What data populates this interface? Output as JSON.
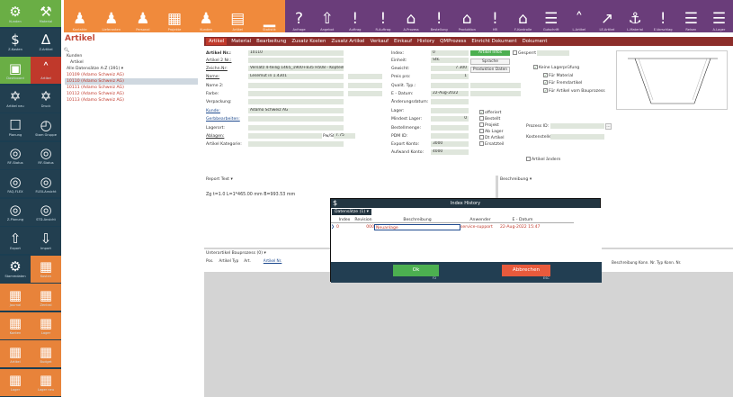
{
  "toolbar": {
    "orange_items": [
      {
        "icon": "person-icon",
        "glyph": "♟",
        "label": "Kontakte"
      },
      {
        "icon": "person-icon",
        "glyph": "♟",
        "label": "Lieferanten"
      },
      {
        "icon": "people-icon",
        "glyph": "♟",
        "label": "Personal"
      },
      {
        "icon": "grid-icon",
        "glyph": "▦",
        "label": "Projekte"
      },
      {
        "icon": "people-icon",
        "glyph": "♟",
        "label": "Kunden"
      },
      {
        "icon": "table-icon",
        "glyph": "▤",
        "label": "Artikel"
      },
      {
        "icon": "chart-icon",
        "glyph": "▁",
        "label": "Statistik"
      }
    ],
    "purple_items": [
      {
        "icon": "question-icon",
        "glyph": "?",
        "label": "Anfrage"
      },
      {
        "icon": "export-icon",
        "glyph": "⇧",
        "label": "Angebot"
      },
      {
        "icon": "alert-icon",
        "glyph": "!",
        "label": "Auftrag"
      },
      {
        "icon": "alert-icon",
        "glyph": "!",
        "label": "R-Auftrag"
      },
      {
        "icon": "home-icon",
        "glyph": "⌂",
        "label": "A-Prozess"
      },
      {
        "icon": "alert-icon",
        "glyph": "!",
        "label": "Bestellung"
      },
      {
        "icon": "home-icon",
        "glyph": "⌂",
        "label": "Produktion"
      },
      {
        "icon": "alert-icon",
        "glyph": "!",
        "label": "HR"
      },
      {
        "icon": "home-icon",
        "glyph": "⌂",
        "label": "F-Kontrolle"
      },
      {
        "icon": "doc-icon",
        "glyph": "☰",
        "label": "Gutschrift"
      },
      {
        "icon": "arrow-up-icon",
        "glyph": "˄",
        "label": "L-Artikel"
      },
      {
        "icon": "arrow-icon",
        "glyph": "↗",
        "label": "LE-Artikel"
      },
      {
        "icon": "ship-icon",
        "glyph": "⚓",
        "label": "L-Material"
      },
      {
        "icon": "alert-icon",
        "glyph": "!",
        "label": "E-Vorschlag"
      },
      {
        "icon": "doc-icon",
        "glyph": "☰",
        "label": "Reisen"
      },
      {
        "icon": "doc-icon",
        "glyph": "☰",
        "label": "A-Lager"
      }
    ]
  },
  "sidebar": {
    "items": [
      {
        "icon": "gear-icon",
        "glyph": "⚙",
        "label": "Kunden",
        "color": "green"
      },
      {
        "icon": "material-icon",
        "glyph": "⚒",
        "label": "Material",
        "color": "green"
      },
      {
        "icon": "dollar-icon",
        "glyph": "$",
        "label": "Z-Kosten",
        "color": "dark"
      },
      {
        "icon": "triangle-icon",
        "glyph": "∆",
        "label": "Z-Artikel",
        "color": "dark"
      },
      {
        "icon": "board-icon",
        "glyph": "▣",
        "label": "Dashboard",
        "color": "green"
      },
      {
        "icon": "artikel-icon",
        "glyph": "˄",
        "label": "Artikel",
        "color": "red"
      },
      {
        "icon": "molecule-icon",
        "glyph": "✡",
        "label": "Artikel neu",
        "color": "dark"
      },
      {
        "icon": "molecule-icon",
        "glyph": "✡",
        "label": "Druck",
        "color": "dark"
      },
      {
        "icon": "flow-icon",
        "glyph": "☐",
        "label": "Planung",
        "color": "dark"
      },
      {
        "icon": "clock-icon",
        "glyph": "◴",
        "label": "Stam Gruppe",
        "color": "dark"
      },
      {
        "icon": "camera-icon",
        "glyph": "◎",
        "label": "RF-Status",
        "color": "dark"
      },
      {
        "icon": "camera-icon",
        "glyph": "◎",
        "label": "RF-Status",
        "color": "dark"
      },
      {
        "icon": "camera-icon",
        "glyph": "◎",
        "label": "FAQ-FLEX",
        "color": "dark"
      },
      {
        "icon": "camera-icon",
        "glyph": "◎",
        "label": "FLEX-Ansicht",
        "color": "dark"
      },
      {
        "icon": "camera-icon",
        "glyph": "◎",
        "label": "Z-Planung",
        "color": "dark"
      },
      {
        "icon": "camera-icon",
        "glyph": "◎",
        "label": "STD-Ansicht",
        "color": "dark"
      },
      {
        "icon": "export-icon",
        "glyph": "⇧",
        "label": "Export",
        "color": "dark"
      },
      {
        "icon": "import-icon",
        "glyph": "⇩",
        "label": "Import",
        "color": "dark"
      },
      {
        "icon": "gear-icon",
        "glyph": "⚙",
        "label": "Stammdaten",
        "color": "dark"
      },
      {
        "icon": "grid-icon",
        "glyph": "▦",
        "label": "Kosten",
        "color": "orange"
      },
      {
        "icon": "grid-icon",
        "glyph": "▦",
        "label": "Journal",
        "color": "orange"
      },
      {
        "icon": "grid-icon",
        "glyph": "▦",
        "label": "Zentral",
        "color": "orange"
      },
      {
        "icon": "grid-icon",
        "glyph": "▦",
        "label": "Konten",
        "color": "orange"
      },
      {
        "icon": "grid-icon",
        "glyph": "▦",
        "label": "Lager",
        "color": "orange"
      },
      {
        "icon": "grid-icon",
        "glyph": "▦",
        "label": "Artikel",
        "color": "orange"
      },
      {
        "icon": "grid-icon",
        "glyph": "▦",
        "label": "Budget",
        "color": "orange"
      },
      {
        "icon": "grid-icon",
        "glyph": "▦",
        "label": "Lager",
        "color": "orange"
      },
      {
        "icon": "grid-icon",
        "glyph": "▦",
        "label": "Lager neu",
        "color": "orange"
      }
    ]
  },
  "header": {
    "title": "Artikel"
  },
  "tabs": [
    "Artikel",
    "Material",
    "Bearbeitung",
    "Zusatz Kosten",
    "Zusatz Artikel",
    "Verkauf",
    "Einkauf",
    "History",
    "QMProzess",
    "Einricht Dokument",
    "Dokument"
  ],
  "tree": {
    "search": "",
    "lines": [
      {
        "text": "Kunden",
        "cls": ""
      },
      {
        "text": "Artikel",
        "cls": ""
      },
      {
        "text": "Alle Datensätze A-Z (391) ▾",
        "cls": ""
      },
      {
        "text": "10109 (Adamo Schweiz AG)",
        "cls": "tree-red"
      },
      {
        "text": "10110 (Adamo Schweiz AG)",
        "cls": "tree-red tree-sel"
      },
      {
        "text": "10111 (Adamo Schweiz AG)",
        "cls": "tree-red"
      },
      {
        "text": "10112 (Adamo Schweiz AG)",
        "cls": "tree-red"
      },
      {
        "text": "10113 (Adamo Schweiz AG)",
        "cls": "tree-red"
      }
    ]
  },
  "form": {
    "artikel_nr_label": "Artikel Nr.:",
    "artikel_nr": "10110",
    "artikel_2_label": "Artikel 2 Nr.:",
    "artikel_2": "",
    "zeichn_label": "Zeichn.Nr:",
    "zeichn": "Versatz 4-teilig 1465_1900+835 H508 - Kopteilband_2",
    "name_label": "Name:",
    "name": "Lesemut in 1.4301",
    "name2_label": "Name 2:",
    "name2": "",
    "farbe_label": "Farbe:",
    "farbe": "",
    "verpackung_label": "Verpackung:",
    "verpackung": "",
    "kunde_label": "Kunde:",
    "kunde": "Adamo Schweiz AG",
    "gerbebearbeiten_label": "Gerbbearbeiten:",
    "gerbebearbeiten": "",
    "lagerort_label": "Lagerort:",
    "lagerort": "",
    "ablagen_label": "Ablagen:",
    "ablagen": "",
    "preis_label": "Pw/St.:",
    "preis": "7.75",
    "kategorie_label": "Artikel Kategorie:",
    "kategorie": "",
    "index_label": "Index:",
    "index": "0",
    "einheit_label": "Einheit:",
    "einheit": "Stk.",
    "gewicht_label": "Gewicht:",
    "gewicht": "7.300",
    "preis_pro_label": "Preis pro:",
    "preis_pro": "1",
    "qualit_label": "Qualit. Typ.:",
    "qualit": "",
    "edatum_label": "E - Datum:",
    "edatum": "22-Aug-2022",
    "aenderung_label": "Änderungsdatum:",
    "aenderung": "",
    "lager_label": "Lager:",
    "lager": "",
    "mindest_label": "Mindest Lager:",
    "mindest": "0",
    "bestellmenge_label": "Bestellmenge:",
    "bestellmenge": "",
    "pdm_label": "PDM ID:",
    "pdm": "",
    "export_label": "Export Konto:",
    "export": "3000",
    "aufwand_label": "Aufwand Konto:",
    "aufwand": "4000",
    "btn_artikel": "Artikel Infos",
    "btn_sprache": "Sprache",
    "btn_produktion": "Produktion Daten",
    "gesperrt": "Gesperrt",
    "keine_lager": "Keine Lagerprüfung",
    "fuer_material": "Für Material",
    "fuer_fremd": "Für Fremdartikel",
    "fuer_bauzug": "Für Artikel vom Bauprozess",
    "offeriert": "offeriert",
    "bestellt": "Bestellt",
    "projekt": "Projekt",
    "ab_lager": "Ab Lager",
    "dp_artikel": "Dt Artikel",
    "ersatzteil": "Ersatzteil",
    "prozess_label": "Prozess ID:",
    "prozess": "",
    "kosten_label": "Kostenstelle:",
    "kosten": "",
    "artikel_aendern": "Artikel ändern"
  },
  "report": {
    "label": "Report Text ▾",
    "text": "Zg  t=1.0  L=1*465.00 mm B=993.53 mm"
  },
  "beschreibung": {
    "label": "Beschreibung ▾"
  },
  "unterartikel": {
    "label": "Unterartikel Bauprozess (0) ▾",
    "cols": [
      "Pos.",
      "Artikel Typ",
      "Art.",
      "Artikel Nr."
    ],
    "right_cols": "Beschreibung Konn. Nr. Typ Konn. Nr."
  },
  "dialog": {
    "title": "Index History",
    "filter": "Datensätze (1) ▾",
    "headers": [
      "Index",
      "Revision",
      "Beschreibung",
      "Anwender",
      "E - Datum"
    ],
    "rows": [
      [
        "0",
        "000",
        "Neuanlage",
        "service-support",
        "22-Aug-2022 15:47"
      ]
    ],
    "ok": "Ok",
    "ok_key": "F2",
    "cancel": "Abbrechen",
    "cancel_key": "ESC"
  },
  "colors": {
    "orange": "#f08a3c",
    "purple": "#6a3d7a",
    "red": "#c0392b",
    "sidebar": "#1b3e52",
    "green": "#4caf50"
  }
}
